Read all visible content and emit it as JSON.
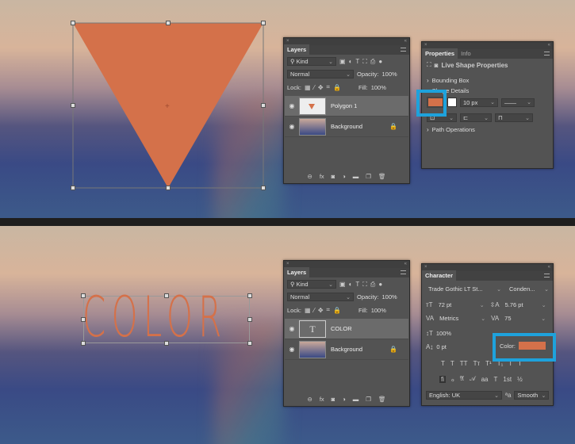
{
  "top": {
    "layers_panel": {
      "tab": "Layers",
      "filter": "Kind",
      "blend_mode": "Normal",
      "opacity_label": "Opacity:",
      "opacity": "100%",
      "lock_label": "Lock:",
      "fill_label": "Fill:",
      "fill": "100%",
      "layers": [
        {
          "name": "Polygon 1",
          "selected": true
        },
        {
          "name": "Background",
          "locked": true
        }
      ]
    },
    "properties_panel": {
      "tabs": [
        "Properties",
        "Info"
      ],
      "title": "Live Shape Properties",
      "bounding_box": "Bounding Box",
      "shape_details": "Shape Details",
      "stroke_width": "10 px",
      "path_operations": "Path Operations",
      "fill_color": "#d4714a"
    }
  },
  "bottom": {
    "canvas_text": "COLOR",
    "layers_panel": {
      "tab": "Layers",
      "filter": "Kind",
      "blend_mode": "Normal",
      "opacity_label": "Opacity:",
      "opacity": "100%",
      "lock_label": "Lock:",
      "fill_label": "Fill:",
      "fill": "100%",
      "layers": [
        {
          "name": "COLOR",
          "type_icon": "T",
          "selected": true
        },
        {
          "name": "Background",
          "locked": true
        }
      ]
    },
    "character_panel": {
      "tab": "Character",
      "font_family": "Trade Gothic LT St...",
      "font_style": "Conden...",
      "font_size": "72 pt",
      "leading": "5.76 pt",
      "kerning": "Metrics",
      "tracking": "75",
      "vertical_scale": "100%",
      "baseline_shift": "0 pt",
      "color_label": "Color:",
      "color": "#d4714a",
      "language": "English: UK",
      "aa_icon": "ªa",
      "antialias": "Smooth",
      "style_buttons": [
        "T",
        "T",
        "TT",
        "Tт",
        "T¹",
        "T₁",
        "T",
        "T"
      ],
      "opentype_buttons": [
        "ﬁ",
        "ℴ",
        "𝔄",
        "𝒜",
        "aa",
        "T",
        "1st",
        "½"
      ]
    }
  },
  "accent": "#1ea2dc"
}
